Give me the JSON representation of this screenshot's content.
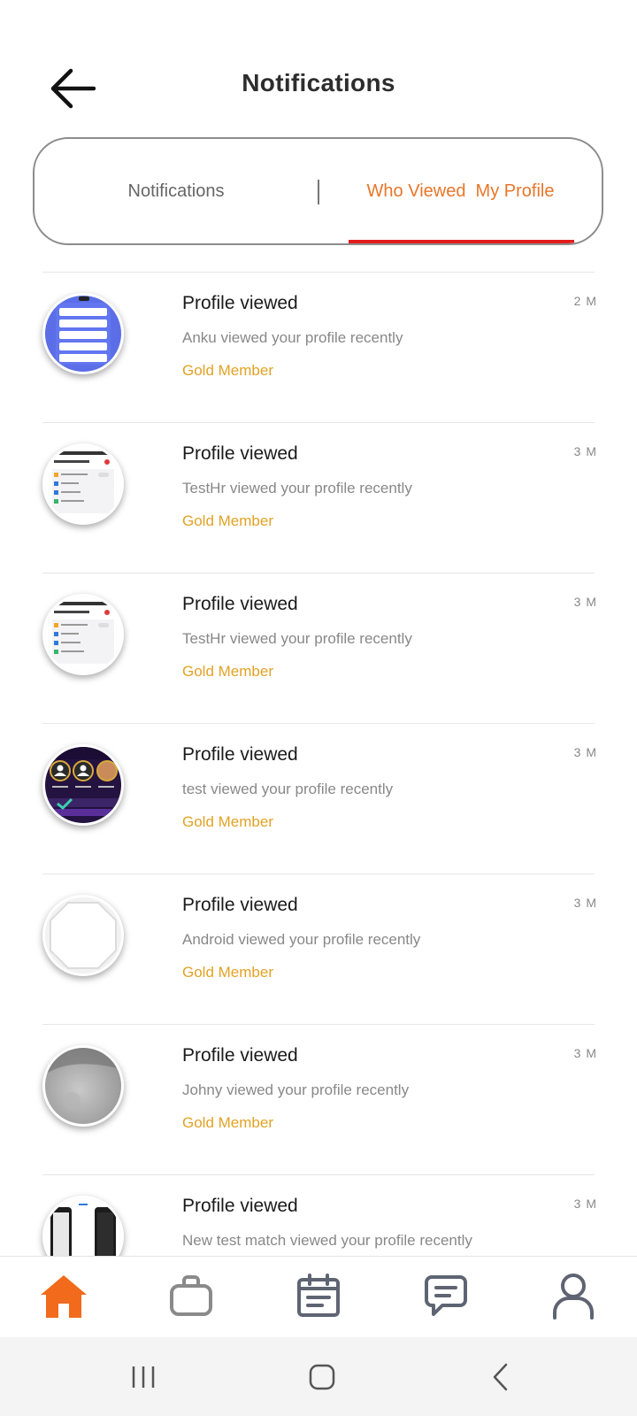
{
  "header": {
    "title": "Notifications"
  },
  "tabs": [
    {
      "label": "Notifications",
      "active": false
    },
    {
      "label": "Who Viewed  My Profile",
      "active": true
    }
  ],
  "colors": {
    "accent": "#e8762b",
    "badge": "#e2a224",
    "tab_underline": "#e31d1d"
  },
  "notifications": [
    {
      "title": "Profile viewed",
      "description": "Anku viewed your profile recently",
      "badge": "Gold Member",
      "time": "2 M",
      "avatar": "blue-stack-photo"
    },
    {
      "title": "Profile viewed",
      "description": "TestHr viewed your profile recently",
      "badge": "Gold Member",
      "time": "3 M",
      "avatar": "settings-screenshot-photo"
    },
    {
      "title": "Profile viewed",
      "description": "TestHr viewed your profile recently",
      "badge": "Gold Member",
      "time": "3 M",
      "avatar": "settings-screenshot-photo"
    },
    {
      "title": "Profile viewed",
      "description": "test viewed your profile recently",
      "badge": "Gold Member",
      "time": "3 M",
      "avatar": "purple-leaderboard-photo"
    },
    {
      "title": "Profile viewed",
      "description": "Android viewed your profile recently",
      "badge": "Gold Member",
      "time": "3 M",
      "avatar": "blank-octagon-photo"
    },
    {
      "title": "Profile viewed",
      "description": "Johny viewed your profile recently",
      "badge": "Gold Member",
      "time": "3 M",
      "avatar": "grey-blurred-photo"
    },
    {
      "title": "Profile viewed",
      "description": "New test match viewed your profile recently",
      "badge": "",
      "time": "3 M",
      "avatar": "phones-photo"
    }
  ],
  "bottom_nav": [
    {
      "icon": "home-icon",
      "active": true
    },
    {
      "icon": "briefcase-icon",
      "active": false
    },
    {
      "icon": "calendar-icon",
      "active": false
    },
    {
      "icon": "chat-icon",
      "active": false
    },
    {
      "icon": "profile-icon",
      "active": false
    }
  ],
  "system_nav": [
    "recent-apps-icon",
    "home-circle-icon",
    "back-chevron-icon"
  ]
}
